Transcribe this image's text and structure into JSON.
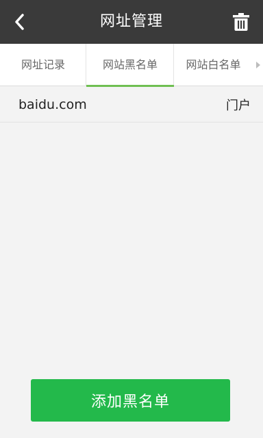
{
  "header": {
    "title": "网址管理"
  },
  "tabs": [
    {
      "label": "网址记录",
      "active": false
    },
    {
      "label": "网站黑名单",
      "active": true
    },
    {
      "label": "网站白名单",
      "active": false
    }
  ],
  "blacklist": [
    {
      "url": "baidu.com",
      "category": "门户"
    }
  ],
  "actions": {
    "add_label": "添加黑名单"
  },
  "colors": {
    "header_bg": "#3a3a3a",
    "accent": "#23b94b",
    "tab_indicator": "#6fbf52"
  },
  "icons": {
    "back": "chevron-left-icon",
    "delete": "trash-icon",
    "more_tabs": "triangle-right-icon"
  }
}
